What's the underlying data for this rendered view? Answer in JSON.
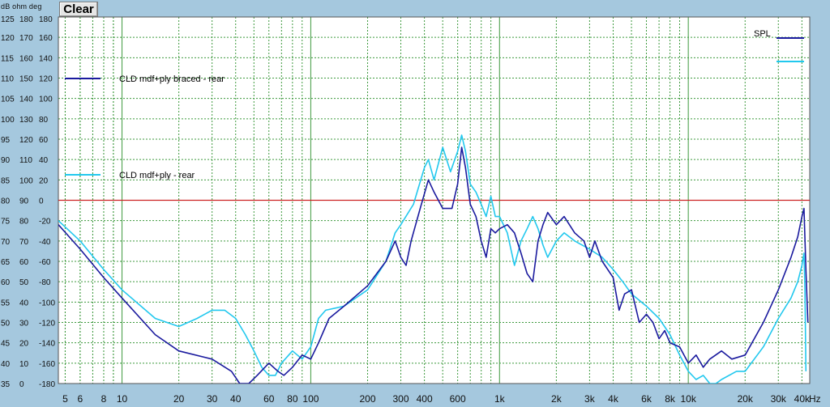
{
  "toolbar": {
    "clear_label": "Clear"
  },
  "axis": {
    "units_header": "dB  ohm deg",
    "hz_unit": "Hz"
  },
  "colors": {
    "plot_bg": "#ffffff",
    "grid": "#3f9a3f",
    "reference_line": "#cc2222",
    "series_1": "#1a1a9e",
    "series_2": "#22c8ee",
    "chrome": "#a5c8de"
  },
  "chart_data": {
    "type": "line",
    "xscale": "log",
    "xlim": [
      4.6,
      44000
    ],
    "ylim": [
      35,
      125
    ],
    "y_left_ticks": {
      "db": [
        "125",
        "120",
        "115",
        "110",
        "105",
        "100",
        "95",
        "90",
        "85",
        "80",
        "75",
        "70",
        "65",
        "60",
        "55",
        "50",
        "45",
        "40",
        "35"
      ],
      "ohm": [
        "180",
        "170",
        "160",
        "150",
        "140",
        "130",
        "120",
        "110",
        "100",
        "90",
        "80",
        "70",
        "60",
        "50",
        "40",
        "30",
        "20",
        "10",
        "0"
      ],
      "deg": [
        "180",
        "160",
        "140",
        "120",
        "100",
        "80",
        "60",
        "40",
        "20",
        "0",
        "-20",
        "-40",
        "-60",
        "-80",
        "-100",
        "-120",
        "-140",
        "-160",
        "-180"
      ]
    },
    "x_tick_labels": [
      {
        "x": 5,
        "label": "5"
      },
      {
        "x": 6,
        "label": "6"
      },
      {
        "x": 8,
        "label": "8"
      },
      {
        "x": 10,
        "label": "10"
      },
      {
        "x": 20,
        "label": "20"
      },
      {
        "x": 30,
        "label": "30"
      },
      {
        "x": 40,
        "label": "40"
      },
      {
        "x": 60,
        "label": "60"
      },
      {
        "x": 80,
        "label": "80"
      },
      {
        "x": 100,
        "label": "100"
      },
      {
        "x": 200,
        "label": "200"
      },
      {
        "x": 300,
        "label": "300"
      },
      {
        "x": 400,
        "label": "400"
      },
      {
        "x": 600,
        "label": "600"
      },
      {
        "x": 1000,
        "label": "1k"
      },
      {
        "x": 2000,
        "label": "2k"
      },
      {
        "x": 3000,
        "label": "3k"
      },
      {
        "x": 4000,
        "label": "4k"
      },
      {
        "x": 6000,
        "label": "6k"
      },
      {
        "x": 8000,
        "label": "8k"
      },
      {
        "x": 10000,
        "label": "10k"
      },
      {
        "x": 20000,
        "label": "20k"
      },
      {
        "x": 30000,
        "label": "30k"
      },
      {
        "x": 40000,
        "label": "40k"
      }
    ],
    "reference_db": 80,
    "legend_top_right": "SPL",
    "series": [
      {
        "name": "CLD mdf+ply braced - rear",
        "color": "#1a1a9e",
        "points": [
          [
            4.6,
            74
          ],
          [
            6,
            68
          ],
          [
            8,
            61
          ],
          [
            10,
            56
          ],
          [
            15,
            47
          ],
          [
            20,
            43
          ],
          [
            30,
            41
          ],
          [
            38,
            38
          ],
          [
            42,
            35
          ],
          [
            47,
            35
          ],
          [
            52,
            37
          ],
          [
            60,
            40
          ],
          [
            67,
            38
          ],
          [
            72,
            37
          ],
          [
            80,
            39
          ],
          [
            90,
            42
          ],
          [
            100,
            41
          ],
          [
            110,
            45
          ],
          [
            125,
            51
          ],
          [
            150,
            54
          ],
          [
            200,
            59
          ],
          [
            250,
            65
          ],
          [
            280,
            70
          ],
          [
            300,
            66
          ],
          [
            320,
            64
          ],
          [
            340,
            70
          ],
          [
            380,
            78
          ],
          [
            420,
            85
          ],
          [
            450,
            82
          ],
          [
            500,
            78
          ],
          [
            560,
            78
          ],
          [
            600,
            84
          ],
          [
            630,
            93
          ],
          [
            660,
            88
          ],
          [
            700,
            79
          ],
          [
            750,
            76
          ],
          [
            800,
            70
          ],
          [
            850,
            66
          ],
          [
            900,
            73
          ],
          [
            950,
            72
          ],
          [
            1000,
            73
          ],
          [
            1100,
            74
          ],
          [
            1200,
            72
          ],
          [
            1300,
            67
          ],
          [
            1400,
            62
          ],
          [
            1500,
            60
          ],
          [
            1600,
            70
          ],
          [
            1700,
            74
          ],
          [
            1800,
            77
          ],
          [
            2000,
            74
          ],
          [
            2200,
            76
          ],
          [
            2500,
            72
          ],
          [
            2800,
            70
          ],
          [
            3000,
            66
          ],
          [
            3200,
            70
          ],
          [
            3500,
            65
          ],
          [
            4000,
            61
          ],
          [
            4300,
            53
          ],
          [
            4600,
            57
          ],
          [
            5000,
            58
          ],
          [
            5500,
            50
          ],
          [
            6000,
            52
          ],
          [
            6500,
            50
          ],
          [
            7000,
            46
          ],
          [
            7500,
            48
          ],
          [
            8000,
            45
          ],
          [
            9000,
            44
          ],
          [
            10000,
            40
          ],
          [
            11000,
            42
          ],
          [
            12000,
            39
          ],
          [
            13000,
            41
          ],
          [
            15000,
            43
          ],
          [
            17000,
            41
          ],
          [
            20000,
            42
          ],
          [
            25000,
            50
          ],
          [
            30000,
            58
          ],
          [
            35000,
            66
          ],
          [
            38000,
            71
          ],
          [
            40000,
            76
          ],
          [
            41000,
            78
          ],
          [
            42000,
            63
          ],
          [
            43000,
            50
          ]
        ]
      },
      {
        "name": "CLD mdf+ply - rear",
        "color": "#22c8ee",
        "points": [
          [
            4.6,
            75
          ],
          [
            6,
            70
          ],
          [
            8,
            63
          ],
          [
            10,
            58
          ],
          [
            15,
            51
          ],
          [
            20,
            49
          ],
          [
            25,
            51
          ],
          [
            30,
            53
          ],
          [
            35,
            53
          ],
          [
            40,
            51
          ],
          [
            45,
            47
          ],
          [
            50,
            43
          ],
          [
            55,
            39
          ],
          [
            60,
            37
          ],
          [
            65,
            37
          ],
          [
            70,
            40
          ],
          [
            80,
            43
          ],
          [
            90,
            41
          ],
          [
            100,
            44
          ],
          [
            110,
            51
          ],
          [
            120,
            53
          ],
          [
            150,
            54
          ],
          [
            200,
            58
          ],
          [
            250,
            65
          ],
          [
            280,
            72
          ],
          [
            300,
            74
          ],
          [
            350,
            79
          ],
          [
            400,
            88
          ],
          [
            420,
            90
          ],
          [
            450,
            85
          ],
          [
            500,
            93
          ],
          [
            550,
            87
          ],
          [
            600,
            92
          ],
          [
            630,
            96
          ],
          [
            660,
            92
          ],
          [
            700,
            84
          ],
          [
            750,
            82
          ],
          [
            800,
            79
          ],
          [
            850,
            76
          ],
          [
            900,
            81
          ],
          [
            950,
            76
          ],
          [
            1000,
            76
          ],
          [
            1100,
            72
          ],
          [
            1200,
            64
          ],
          [
            1300,
            70
          ],
          [
            1400,
            73
          ],
          [
            1500,
            76
          ],
          [
            1600,
            73
          ],
          [
            1700,
            69
          ],
          [
            1800,
            66
          ],
          [
            2000,
            70
          ],
          [
            2200,
            72
          ],
          [
            2500,
            70
          ],
          [
            3000,
            68
          ],
          [
            3500,
            66
          ],
          [
            4000,
            63
          ],
          [
            4500,
            60
          ],
          [
            5000,
            57
          ],
          [
            6000,
            54
          ],
          [
            7000,
            51
          ],
          [
            8000,
            47
          ],
          [
            9000,
            42
          ],
          [
            10000,
            38
          ],
          [
            11000,
            36
          ],
          [
            12000,
            37
          ],
          [
            13000,
            35
          ],
          [
            14000,
            35
          ],
          [
            15000,
            36
          ],
          [
            18000,
            38
          ],
          [
            20000,
            38
          ],
          [
            25000,
            44
          ],
          [
            30000,
            51
          ],
          [
            35000,
            56
          ],
          [
            38000,
            60
          ],
          [
            40000,
            64
          ],
          [
            41000,
            67
          ],
          [
            41500,
            58
          ],
          [
            42000,
            38
          ]
        ]
      }
    ]
  }
}
